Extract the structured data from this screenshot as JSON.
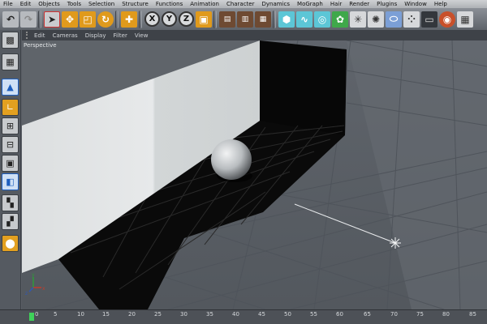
{
  "menubar": {
    "items": [
      "File",
      "Edit",
      "Objects",
      "Tools",
      "Selection",
      "Structure",
      "Functions",
      "Animation",
      "Character",
      "Dynamics",
      "MoGraph",
      "Hair",
      "Render",
      "Plugins",
      "Window",
      "Help"
    ]
  },
  "toolbar": {
    "icons": [
      "undo-icon",
      "redo-icon",
      "live-select-icon",
      "move-icon",
      "scale-icon",
      "rotate-icon",
      "recent-tools-icon",
      "x-axis-lock-icon",
      "y-axis-lock-icon",
      "z-axis-lock-icon",
      "coordinate-system-icon",
      "render-view-icon",
      "render-picture-viewer-icon",
      "render-settings-icon",
      "cube-primitive-icon",
      "spline-icon",
      "nurbs-icon",
      "array-icon",
      "deformer-icon",
      "scene-object-icon",
      "camera-icon",
      "light-icon",
      "floor-icon",
      "record-icon"
    ],
    "axis_labels": {
      "x": "X",
      "y": "Y",
      "z": "Z"
    }
  },
  "leftbar": {
    "icons": [
      "make-editable-icon",
      "texture-mode-icon",
      "model-mode-icon",
      "object-axis-icon",
      "points-mode-icon",
      "edges-mode-icon",
      "polygons-mode-icon",
      "animation-mode-icon",
      "workplane-icon",
      "snapping-icon",
      "solo-icon"
    ]
  },
  "viewport": {
    "menu": [
      "Edit",
      "Cameras",
      "Display",
      "Filter",
      "View"
    ],
    "label": "Perspective",
    "axis_gizmo": {
      "x": "x",
      "y": "y",
      "z": "z"
    }
  },
  "timeline": {
    "ticks": [
      "0",
      "5",
      "10",
      "15",
      "20",
      "25",
      "30",
      "35",
      "40",
      "45",
      "50",
      "55",
      "60",
      "65",
      "70",
      "75",
      "80",
      "85"
    ],
    "current_frame": 0
  },
  "colors": {
    "accent": "#e09a1c",
    "timeline_marker": "#3fd25a",
    "wall_light": "#dfe2e3",
    "shadow_floor": "#0a0a0a"
  }
}
